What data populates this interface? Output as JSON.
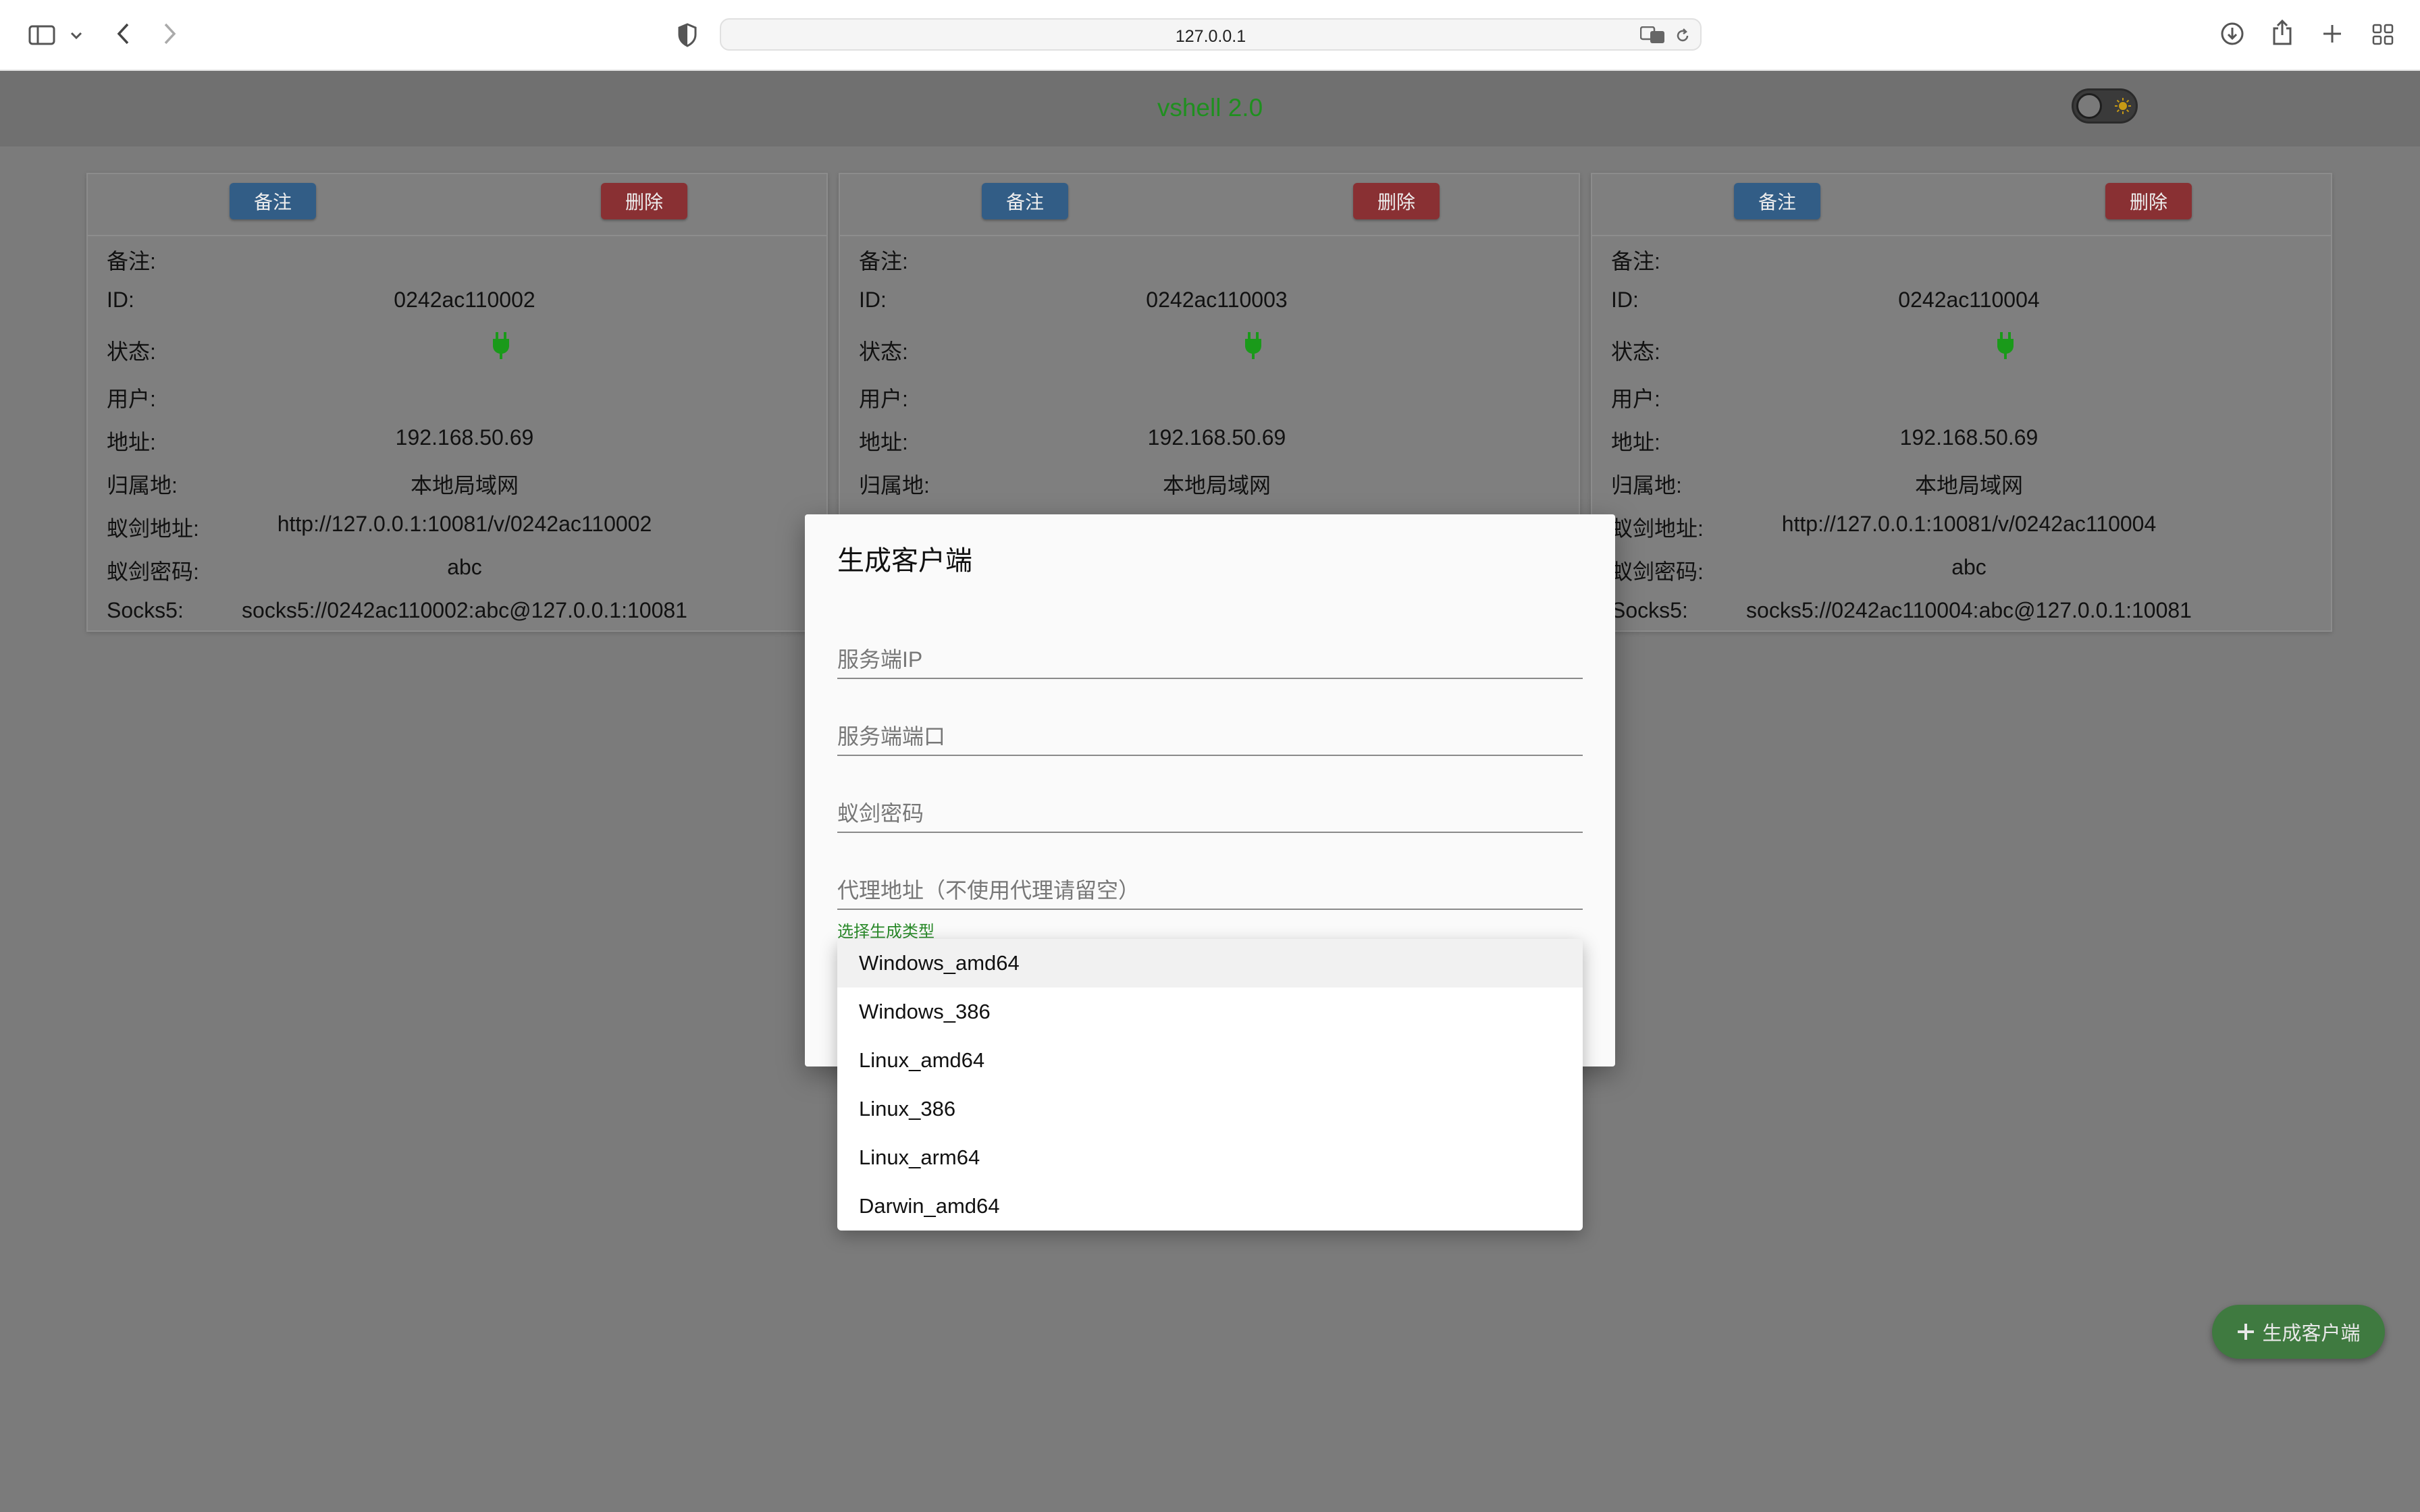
{
  "browser": {
    "url": "127.0.0.1"
  },
  "app": {
    "title": "vshell 2.0"
  },
  "cards": [
    {
      "note_button": "备注",
      "delete_button": "删除",
      "rows": [
        {
          "label": "备注:",
          "value": ""
        },
        {
          "label": "ID:",
          "value": "0242ac110002"
        },
        {
          "label": "状态:",
          "value": ""
        },
        {
          "label": "用户:",
          "value": ""
        },
        {
          "label": "地址:",
          "value": "192.168.50.69"
        },
        {
          "label": "归属地:",
          "value": "本地局域网"
        },
        {
          "label": "蚁剑地址:",
          "value": "http://127.0.0.1:10081/v/0242ac110002"
        },
        {
          "label": "蚁剑密码:",
          "value": "abc"
        },
        {
          "label": "Socks5:",
          "value": "socks5://0242ac110002:abc@127.0.0.1:10081"
        }
      ]
    },
    {
      "note_button": "备注",
      "delete_button": "删除",
      "rows": [
        {
          "label": "备注:",
          "value": ""
        },
        {
          "label": "ID:",
          "value": "0242ac110003"
        },
        {
          "label": "状态:",
          "value": ""
        },
        {
          "label": "用户:",
          "value": ""
        },
        {
          "label": "地址:",
          "value": "192.168.50.69"
        },
        {
          "label": "归属地:",
          "value": "本地局域网"
        }
      ]
    },
    {
      "note_button": "备注",
      "delete_button": "删除",
      "rows": [
        {
          "label": "备注:",
          "value": ""
        },
        {
          "label": "ID:",
          "value": "0242ac110004"
        },
        {
          "label": "状态:",
          "value": ""
        },
        {
          "label": "用户:",
          "value": ""
        },
        {
          "label": "地址:",
          "value": "192.168.50.69"
        },
        {
          "label": "归属地:",
          "value": "本地局域网"
        },
        {
          "label": "蚁剑地址:",
          "value": "http://127.0.0.1:10081/v/0242ac110004"
        },
        {
          "label": "蚁剑密码:",
          "value": "abc"
        },
        {
          "label": "Socks5:",
          "value": "socks5://0242ac110004:abc@127.0.0.1:10081"
        }
      ]
    }
  ],
  "status_color": "#1a9a1a",
  "dialog": {
    "title": "生成客户端",
    "fields": {
      "server_ip": "服务端IP",
      "server_port": "服务端端口",
      "antsword_password": "蚁剑密码",
      "proxy": "代理地址（不使用代理请留空）"
    },
    "select_label": "选择生成类型",
    "options": [
      "Windows_amd64",
      "Windows_386",
      "Linux_amd64",
      "Linux_386",
      "Linux_arm64",
      "Darwin_amd64"
    ],
    "selected_option": "Windows_amd64"
  },
  "fab": {
    "icon": "plus-icon",
    "label": "生成客户端"
  }
}
